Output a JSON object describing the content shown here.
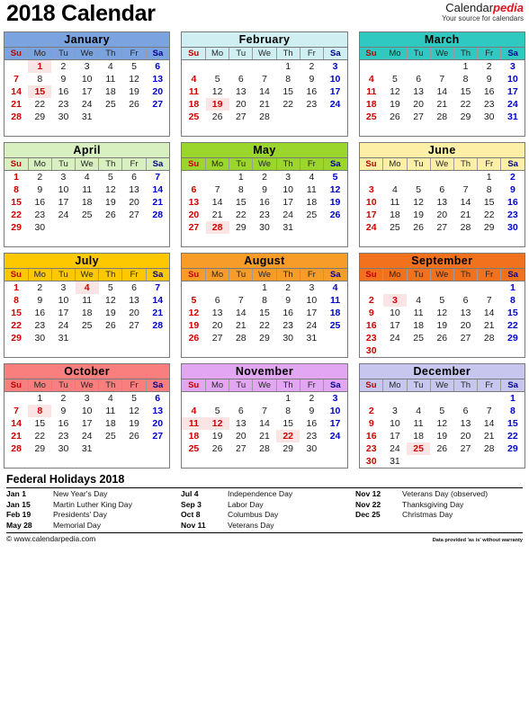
{
  "header": {
    "title": "2018 Calendar",
    "brand_primary": "Calendar",
    "brand_accent": "pedia",
    "brand_tagline": "Your source for calendars"
  },
  "weekdays": [
    "Su",
    "Mo",
    "Tu",
    "We",
    "Th",
    "Fr",
    "Sa"
  ],
  "months": [
    {
      "name": "January",
      "header_bg": "#7aa3e0",
      "title_color": "#000000",
      "weeks": [
        [
          "",
          "1",
          "2",
          "3",
          "4",
          "5",
          "6"
        ],
        [
          "7",
          "8",
          "9",
          "10",
          "11",
          "12",
          "13"
        ],
        [
          "14",
          "15",
          "16",
          "17",
          "18",
          "19",
          "20"
        ],
        [
          "21",
          "22",
          "23",
          "24",
          "25",
          "26",
          "27"
        ],
        [
          "28",
          "29",
          "30",
          "31",
          "",
          "",
          ""
        ],
        [
          "",
          "",
          "",
          "",
          "",
          "",
          ""
        ]
      ],
      "holidays": [
        "1",
        "15"
      ]
    },
    {
      "name": "February",
      "header_bg": "#cfeff2",
      "title_color": "#000000",
      "weeks": [
        [
          "",
          "",
          "",
          "",
          "1",
          "2",
          "3"
        ],
        [
          "4",
          "5",
          "6",
          "7",
          "8",
          "9",
          "10"
        ],
        [
          "11",
          "12",
          "13",
          "14",
          "15",
          "16",
          "17"
        ],
        [
          "18",
          "19",
          "20",
          "21",
          "22",
          "23",
          "24"
        ],
        [
          "25",
          "26",
          "27",
          "28",
          "",
          "",
          ""
        ],
        [
          "",
          "",
          "",
          "",
          "",
          "",
          ""
        ]
      ],
      "holidays": [
        "19"
      ]
    },
    {
      "name": "March",
      "header_bg": "#2fc9c2",
      "title_color": "#000000",
      "weeks": [
        [
          "",
          "",
          "",
          "",
          "1",
          "2",
          "3"
        ],
        [
          "4",
          "5",
          "6",
          "7",
          "8",
          "9",
          "10"
        ],
        [
          "11",
          "12",
          "13",
          "14",
          "15",
          "16",
          "17"
        ],
        [
          "18",
          "19",
          "20",
          "21",
          "22",
          "23",
          "24"
        ],
        [
          "25",
          "26",
          "27",
          "28",
          "29",
          "30",
          "31"
        ],
        [
          "",
          "",
          "",
          "",
          "",
          "",
          ""
        ]
      ],
      "holidays": []
    },
    {
      "name": "April",
      "header_bg": "#d8efc0",
      "title_color": "#000000",
      "weeks": [
        [
          "1",
          "2",
          "3",
          "4",
          "5",
          "6",
          "7"
        ],
        [
          "8",
          "9",
          "10",
          "11",
          "12",
          "13",
          "14"
        ],
        [
          "15",
          "16",
          "17",
          "18",
          "19",
          "20",
          "21"
        ],
        [
          "22",
          "23",
          "24",
          "25",
          "26",
          "27",
          "28"
        ],
        [
          "29",
          "30",
          "",
          "",
          "",
          "",
          ""
        ],
        [
          "",
          "",
          "",
          "",
          "",
          "",
          ""
        ]
      ],
      "holidays": []
    },
    {
      "name": "May",
      "header_bg": "#9ad62b",
      "title_color": "#000000",
      "weeks": [
        [
          "",
          "",
          "1",
          "2",
          "3",
          "4",
          "5"
        ],
        [
          "6",
          "7",
          "8",
          "9",
          "10",
          "11",
          "12"
        ],
        [
          "13",
          "14",
          "15",
          "16",
          "17",
          "18",
          "19"
        ],
        [
          "20",
          "21",
          "22",
          "23",
          "24",
          "25",
          "26"
        ],
        [
          "27",
          "28",
          "29",
          "30",
          "31",
          "",
          ""
        ],
        [
          "",
          "",
          "",
          "",
          "",
          "",
          ""
        ]
      ],
      "holidays": [
        "28"
      ]
    },
    {
      "name": "June",
      "header_bg": "#fdf0a6",
      "title_color": "#000000",
      "weeks": [
        [
          "",
          "",
          "",
          "",
          "",
          "1",
          "2"
        ],
        [
          "3",
          "4",
          "5",
          "6",
          "7",
          "8",
          "9"
        ],
        [
          "10",
          "11",
          "12",
          "13",
          "14",
          "15",
          "16"
        ],
        [
          "17",
          "18",
          "19",
          "20",
          "21",
          "22",
          "23"
        ],
        [
          "24",
          "25",
          "26",
          "27",
          "28",
          "29",
          "30"
        ],
        [
          "",
          "",
          "",
          "",
          "",
          "",
          ""
        ]
      ],
      "holidays": []
    },
    {
      "name": "July",
      "header_bg": "#fdc800",
      "title_color": "#000000",
      "weeks": [
        [
          "1",
          "2",
          "3",
          "4",
          "5",
          "6",
          "7"
        ],
        [
          "8",
          "9",
          "10",
          "11",
          "12",
          "13",
          "14"
        ],
        [
          "15",
          "16",
          "17",
          "18",
          "19",
          "20",
          "21"
        ],
        [
          "22",
          "23",
          "24",
          "25",
          "26",
          "27",
          "28"
        ],
        [
          "29",
          "30",
          "31",
          "",
          "",
          "",
          ""
        ],
        [
          "",
          "",
          "",
          "",
          "",
          "",
          ""
        ]
      ],
      "holidays": [
        "4"
      ]
    },
    {
      "name": "August",
      "header_bg": "#f79c28",
      "title_color": "#000000",
      "weeks": [
        [
          "",
          "",
          "",
          "1",
          "2",
          "3",
          "4"
        ],
        [
          "5",
          "6",
          "7",
          "8",
          "9",
          "10",
          "11"
        ],
        [
          "12",
          "13",
          "14",
          "15",
          "16",
          "17",
          "18"
        ],
        [
          "19",
          "20",
          "21",
          "22",
          "23",
          "24",
          "25"
        ],
        [
          "26",
          "27",
          "28",
          "29",
          "30",
          "31",
          ""
        ],
        [
          "",
          "",
          "",
          "",
          "",
          "",
          ""
        ]
      ],
      "holidays": []
    },
    {
      "name": "September",
      "header_bg": "#f2711c",
      "title_color": "#000000",
      "weeks": [
        [
          "",
          "",
          "",
          "",
          "",
          "",
          "1"
        ],
        [
          "2",
          "3",
          "4",
          "5",
          "6",
          "7",
          "8"
        ],
        [
          "9",
          "10",
          "11",
          "12",
          "13",
          "14",
          "15"
        ],
        [
          "16",
          "17",
          "18",
          "19",
          "20",
          "21",
          "22"
        ],
        [
          "23",
          "24",
          "25",
          "26",
          "27",
          "28",
          "29"
        ],
        [
          "30",
          "",
          "",
          "",
          "",
          "",
          ""
        ]
      ],
      "holidays": [
        "3"
      ]
    },
    {
      "name": "October",
      "header_bg": "#f97f7f",
      "title_color": "#000000",
      "weeks": [
        [
          "",
          "1",
          "2",
          "3",
          "4",
          "5",
          "6"
        ],
        [
          "7",
          "8",
          "9",
          "10",
          "11",
          "12",
          "13"
        ],
        [
          "14",
          "15",
          "16",
          "17",
          "18",
          "19",
          "20"
        ],
        [
          "21",
          "22",
          "23",
          "24",
          "25",
          "26",
          "27"
        ],
        [
          "28",
          "29",
          "30",
          "31",
          "",
          "",
          ""
        ],
        [
          "",
          "",
          "",
          "",
          "",
          "",
          ""
        ]
      ],
      "holidays": [
        "8"
      ]
    },
    {
      "name": "November",
      "header_bg": "#e3a6f2",
      "title_color": "#000000",
      "weeks": [
        [
          "",
          "",
          "",
          "",
          "1",
          "2",
          "3"
        ],
        [
          "4",
          "5",
          "6",
          "7",
          "8",
          "9",
          "10"
        ],
        [
          "11",
          "12",
          "13",
          "14",
          "15",
          "16",
          "17"
        ],
        [
          "18",
          "19",
          "20",
          "21",
          "22",
          "23",
          "24"
        ],
        [
          "25",
          "26",
          "27",
          "28",
          "29",
          "30",
          ""
        ],
        [
          "",
          "",
          "",
          "",
          "",
          "",
          ""
        ]
      ],
      "holidays": [
        "11",
        "12",
        "22"
      ]
    },
    {
      "name": "December",
      "header_bg": "#c6c6ef",
      "title_color": "#000000",
      "weeks": [
        [
          "",
          "",
          "",
          "",
          "",
          "",
          "1"
        ],
        [
          "2",
          "3",
          "4",
          "5",
          "6",
          "7",
          "8"
        ],
        [
          "9",
          "10",
          "11",
          "12",
          "13",
          "14",
          "15"
        ],
        [
          "16",
          "17",
          "18",
          "19",
          "20",
          "21",
          "22"
        ],
        [
          "23",
          "24",
          "25",
          "26",
          "27",
          "28",
          "29"
        ],
        [
          "30",
          "31",
          "",
          "",
          "",
          "",
          ""
        ]
      ],
      "holidays": [
        "25"
      ]
    }
  ],
  "federal_holidays": {
    "title": "Federal Holidays 2018",
    "columns": [
      [
        {
          "date": "Jan 1",
          "name": "New Year's Day"
        },
        {
          "date": "Jan 15",
          "name": "Martin Luther King Day"
        },
        {
          "date": "Feb 19",
          "name": "Presidents' Day"
        },
        {
          "date": "May 28",
          "name": "Memorial Day"
        }
      ],
      [
        {
          "date": "Jul 4",
          "name": "Independence Day"
        },
        {
          "date": "Sep 3",
          "name": "Labor Day"
        },
        {
          "date": "Oct 8",
          "name": "Columbus Day"
        },
        {
          "date": "Nov 11",
          "name": "Veterans Day"
        }
      ],
      [
        {
          "date": "Nov 12",
          "name": "Veterans Day (observed)"
        },
        {
          "date": "Nov 22",
          "name": "Thanksgiving Day"
        },
        {
          "date": "Dec 25",
          "name": "Christmas Day"
        }
      ]
    ]
  },
  "footer": {
    "copyright": "© www.calendarpedia.com",
    "disclaimer": "Data provided 'as is' without warranty"
  },
  "colors": {
    "sunday": "#d00000",
    "saturday": "#0000cd",
    "weekday": "#1a1a1a",
    "holiday_bg": "#fbe4e4",
    "brand_accent": "#e1131d"
  }
}
